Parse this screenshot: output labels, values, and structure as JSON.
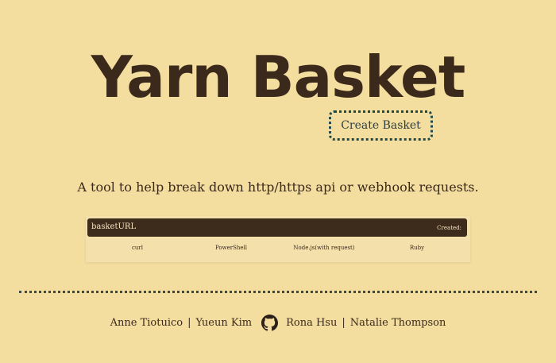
{
  "app": {
    "title": "Yarn Basket"
  },
  "actions": {
    "create_label": "Create Basket"
  },
  "tagline": "A tool to help break down http/https api or webhook requests.",
  "basket": {
    "url_label": "basketURL",
    "created_label": "Created:"
  },
  "tabs": [
    {
      "label": "curl"
    },
    {
      "label": "PowerShell"
    },
    {
      "label": "Node.js(with request)"
    },
    {
      "label": "Ruby"
    }
  ],
  "footer": {
    "authors": [
      "Anne Tiotuico",
      "Yueun Kim",
      "Rona Hsu",
      "Natalie Thompson"
    ],
    "separator": "|",
    "icon": "github-icon"
  },
  "colors": {
    "background": "#f3dd9f",
    "text": "#3b2a1c",
    "button_border": "#1f4a4b",
    "bar": "#3d2b1c"
  }
}
